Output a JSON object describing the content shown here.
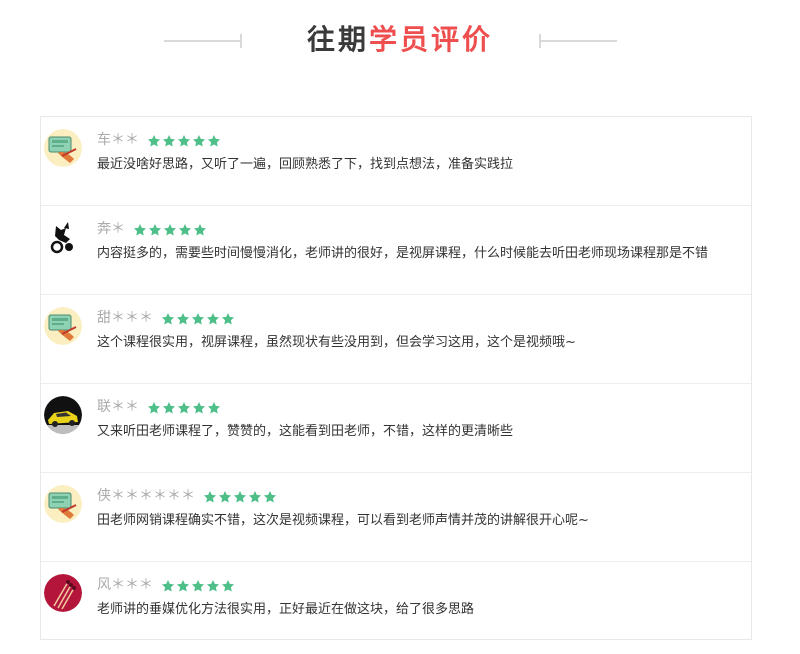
{
  "header": {
    "title_dark": "往期",
    "title_red": "学员评价"
  },
  "colors": {
    "accent_red": "#ee4e4e",
    "star_green": "#4fbf8a",
    "name_gray": "#aaaaaa"
  },
  "reviews": [
    {
      "name": "车＊＊",
      "rating": 5,
      "avatar": "cartoon-notebook-avatar",
      "comment": "最近没啥好思路，又听了一遍，回顾熟悉了下，找到点想法，准备实践拉"
    },
    {
      "name": "奔＊",
      "rating": 5,
      "avatar": "black-horse-rider-avatar",
      "comment": "内容挺多的，需要些时间慢慢消化，老师讲的很好，是视屏课程，什么时候能去听田老师现场课程那是不错"
    },
    {
      "name": "甜＊＊＊",
      "rating": 5,
      "avatar": "cartoon-notebook-avatar",
      "comment": "这个课程很实用，视屏课程，虽然现状有些没用到，但会学习这用，这个是视频哦~"
    },
    {
      "name": "联＊＊",
      "rating": 5,
      "avatar": "yellow-car-avatar",
      "comment": "又来听田老师课程了，赞赞的，这能看到田老师，不错，这样的更清晰些"
    },
    {
      "name": "侠＊＊＊＊＊＊",
      "rating": 5,
      "avatar": "cartoon-notebook-avatar",
      "comment": "田老师网销课程确实不错，这次是视频课程，可以看到老师声情并茂的讲解很开心呢~"
    },
    {
      "name": "风＊＊＊",
      "rating": 5,
      "avatar": "red-matchsticks-avatar",
      "comment": "老师讲的垂媒优化方法很实用，正好最近在做这块，给了很多思路"
    }
  ]
}
